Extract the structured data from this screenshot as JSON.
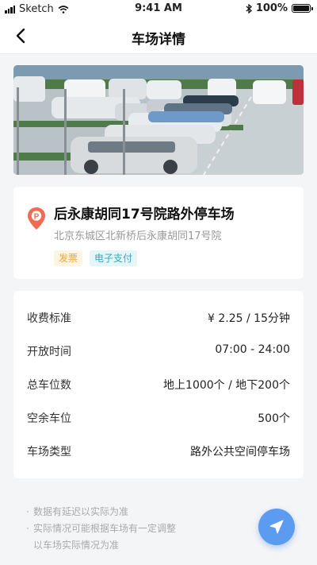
{
  "status_bar": {
    "carrier": "Sketch",
    "time": "9:41 AM",
    "battery": "100%"
  },
  "nav": {
    "title": "车场详情",
    "back_icon": "chevron-left-icon"
  },
  "photo": {
    "icon": "parking-lot-photo"
  },
  "parking_lot": {
    "name": "后永康胡同17号院路外停车场",
    "address": "北京东城区北新桥后永康胡同17号院",
    "icon": "location-pin-icon",
    "tags": [
      "发票",
      "电子支付"
    ],
    "accent_colors": {
      "pin": "#f06b52",
      "invoice": "#e8a93a",
      "pay": "#3aa6b8"
    }
  },
  "details": [
    {
      "label": "收费标准",
      "value": "¥ 2.25 / 15分钟"
    },
    {
      "label": "开放时间",
      "value": "07:00 - 24:00"
    },
    {
      "label": "总车位数",
      "value": "地上1000个 / 地下200个"
    },
    {
      "label": "空余车位",
      "value": "500个"
    },
    {
      "label": "车场类型",
      "value": "路外公共空间停车场"
    }
  ],
  "notes": [
    "数据有延迟以实际为准",
    "实际情况可能根据车场有一定调整",
    "以车场实际情况为准"
  ],
  "fab": {
    "icon": "navigate-arrow-icon",
    "color": "#5b9bf0"
  }
}
